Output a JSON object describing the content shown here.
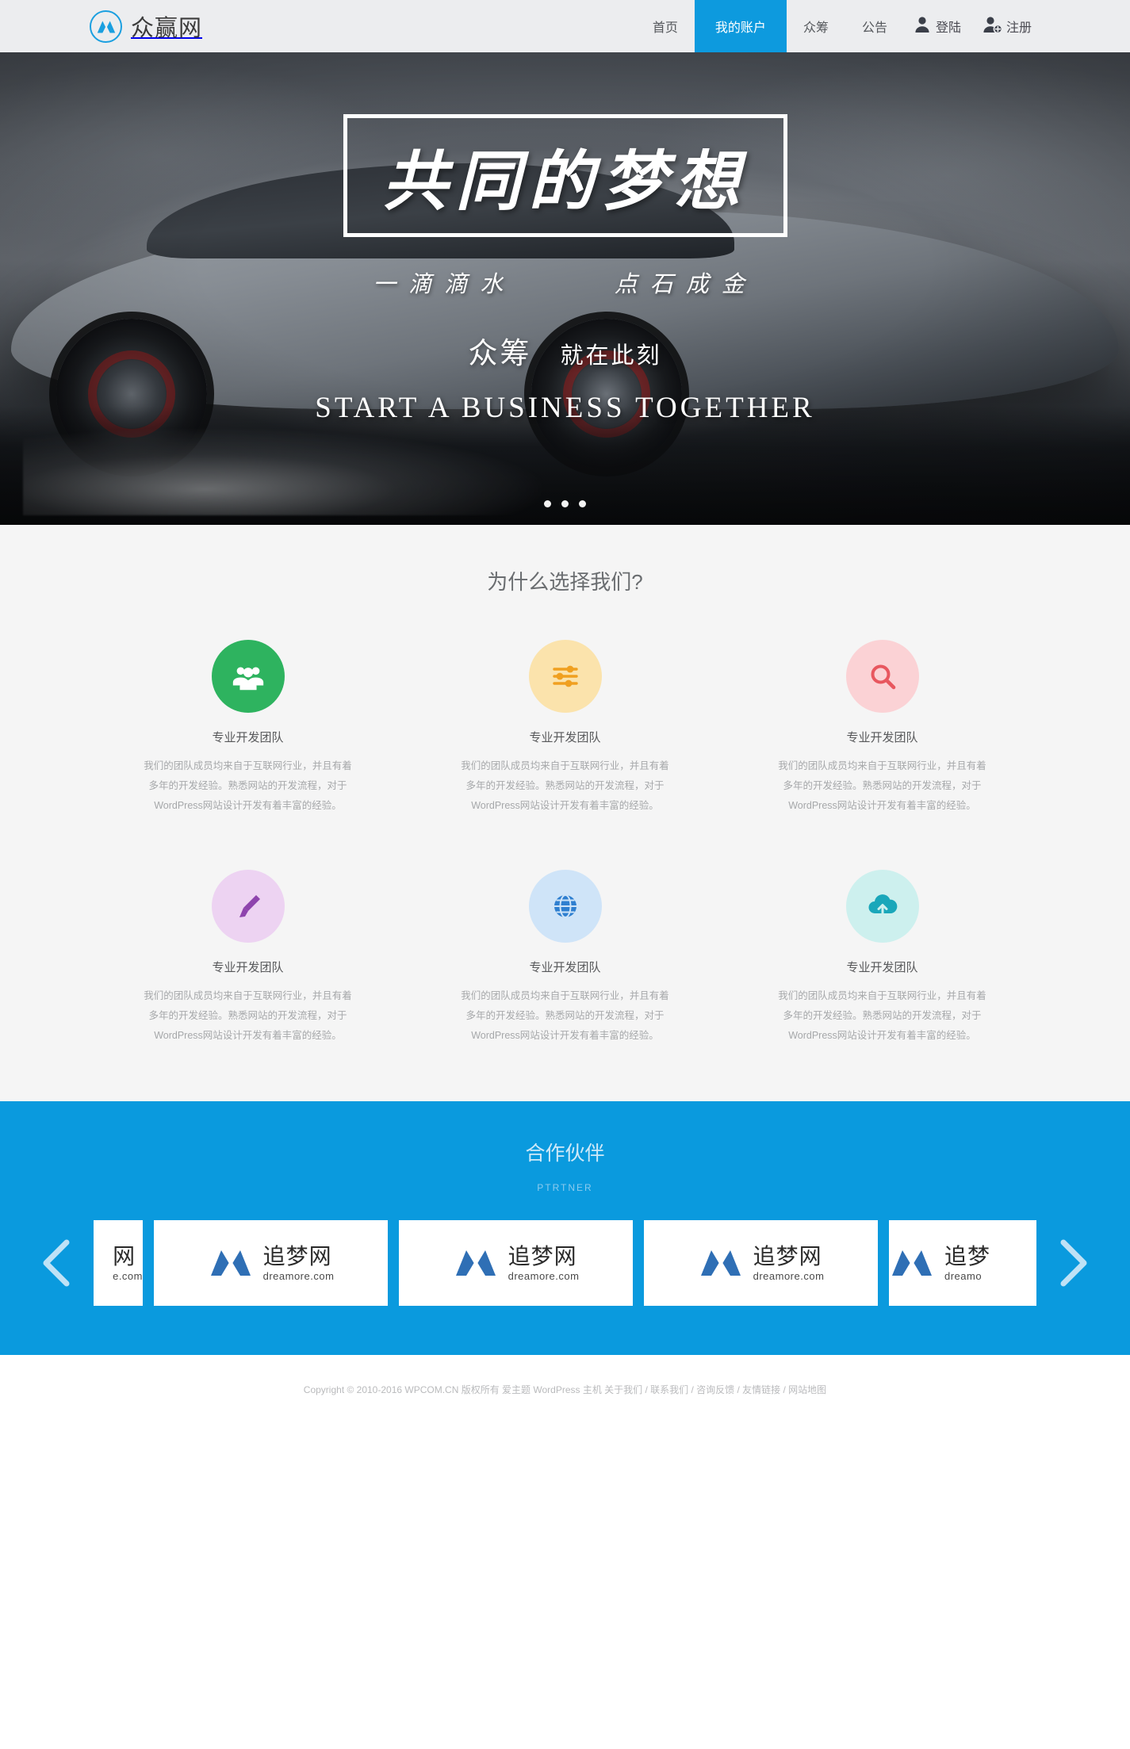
{
  "header": {
    "brand_name": "众赢网",
    "logo_icon": "mountain-circle-logo",
    "nav": [
      {
        "label": "首页",
        "active": false
      },
      {
        "label": "我的账户",
        "active": true
      },
      {
        "label": "众筹",
        "active": false
      },
      {
        "label": "公告",
        "active": false
      }
    ],
    "auth": [
      {
        "label": "登陆",
        "icon": "user-icon"
      },
      {
        "label": "注册",
        "icon": "user-plus-icon"
      }
    ]
  },
  "hero": {
    "headline": "共同的梦想",
    "tagline_left": "一滴滴水",
    "tagline_right": "点石成金",
    "cta_big": "众筹",
    "cta_small": "就在此刻",
    "english": "START A BUSINESS TOGETHER",
    "slide_count": 3,
    "active_slide": 2
  },
  "features": {
    "title": "为什么选择我们?",
    "items": [
      {
        "icon": "users-group-icon",
        "icon_bg": "#2eb35f",
        "icon_color": "#ffffff",
        "title": "专业开发团队",
        "desc": "我们的团队成员均来自于互联网行业，并且有着多年的开发经验。熟悉网站的开发流程，对于WordPress网站设计开发有着丰富的经验。"
      },
      {
        "icon": "sliders-icon",
        "icon_bg": "#fbe3ac",
        "icon_color": "#f0a020",
        "title": "专业开发团队",
        "desc": "我们的团队成员均来自于互联网行业，并且有着多年的开发经验。熟悉网站的开发流程，对于WordPress网站设计开发有着丰富的经验。"
      },
      {
        "icon": "search-icon",
        "icon_bg": "#fbd2d5",
        "icon_color": "#e8575f",
        "title": "专业开发团队",
        "desc": "我们的团队成员均来自于互联网行业，并且有着多年的开发经验。熟悉网站的开发流程，对于WordPress网站设计开发有着丰富的经验。"
      },
      {
        "icon": "paint-brush-icon",
        "icon_bg": "#edd3f2",
        "icon_color": "#8e44ad",
        "title": "专业开发团队",
        "desc": "我们的团队成员均来自于互联网行业，并且有着多年的开发经验。熟悉网站的开发流程，对于WordPress网站设计开发有着丰富的经验。"
      },
      {
        "icon": "globe-icon",
        "icon_bg": "#cfe4f8",
        "icon_color": "#2f7fd0",
        "title": "专业开发团队",
        "desc": "我们的团队成员均来自于互联网行业，并且有着多年的开发经验。熟悉网站的开发流程，对于WordPress网站设计开发有着丰富的经验。"
      },
      {
        "icon": "cloud-upload-icon",
        "icon_bg": "#cdf0ee",
        "icon_color": "#1aa7ba",
        "title": "专业开发团队",
        "desc": "我们的团队成员均来自于互联网行业，并且有着多年的开发经验。熟悉网站的开发流程，对于WordPress网站设计开发有着丰富的经验。"
      }
    ]
  },
  "partners": {
    "title": "合作伙伴",
    "subtitle": "PTRTNER",
    "background": "#0a9ade",
    "prev_icon": "chevron-left-icon",
    "next_icon": "chevron-right-icon",
    "logos": [
      {
        "cn": "网",
        "en": "e.com",
        "partial": "left"
      },
      {
        "cn": "追梦网",
        "en": "dreamore.com",
        "partial": "none"
      },
      {
        "cn": "追梦网",
        "en": "dreamore.com",
        "partial": "none"
      },
      {
        "cn": "追梦网",
        "en": "dreamore.com",
        "partial": "none"
      },
      {
        "cn": "追梦",
        "en": "dreamo",
        "partial": "right"
      }
    ]
  },
  "footer": {
    "copyright": "Copyright © 2010-2016 WPCOM.CN 版权所有 爱主题 WordPress 主机 关于我们 / 联系我们 / 咨询反馈 / 友情链接 / 网站地图"
  }
}
